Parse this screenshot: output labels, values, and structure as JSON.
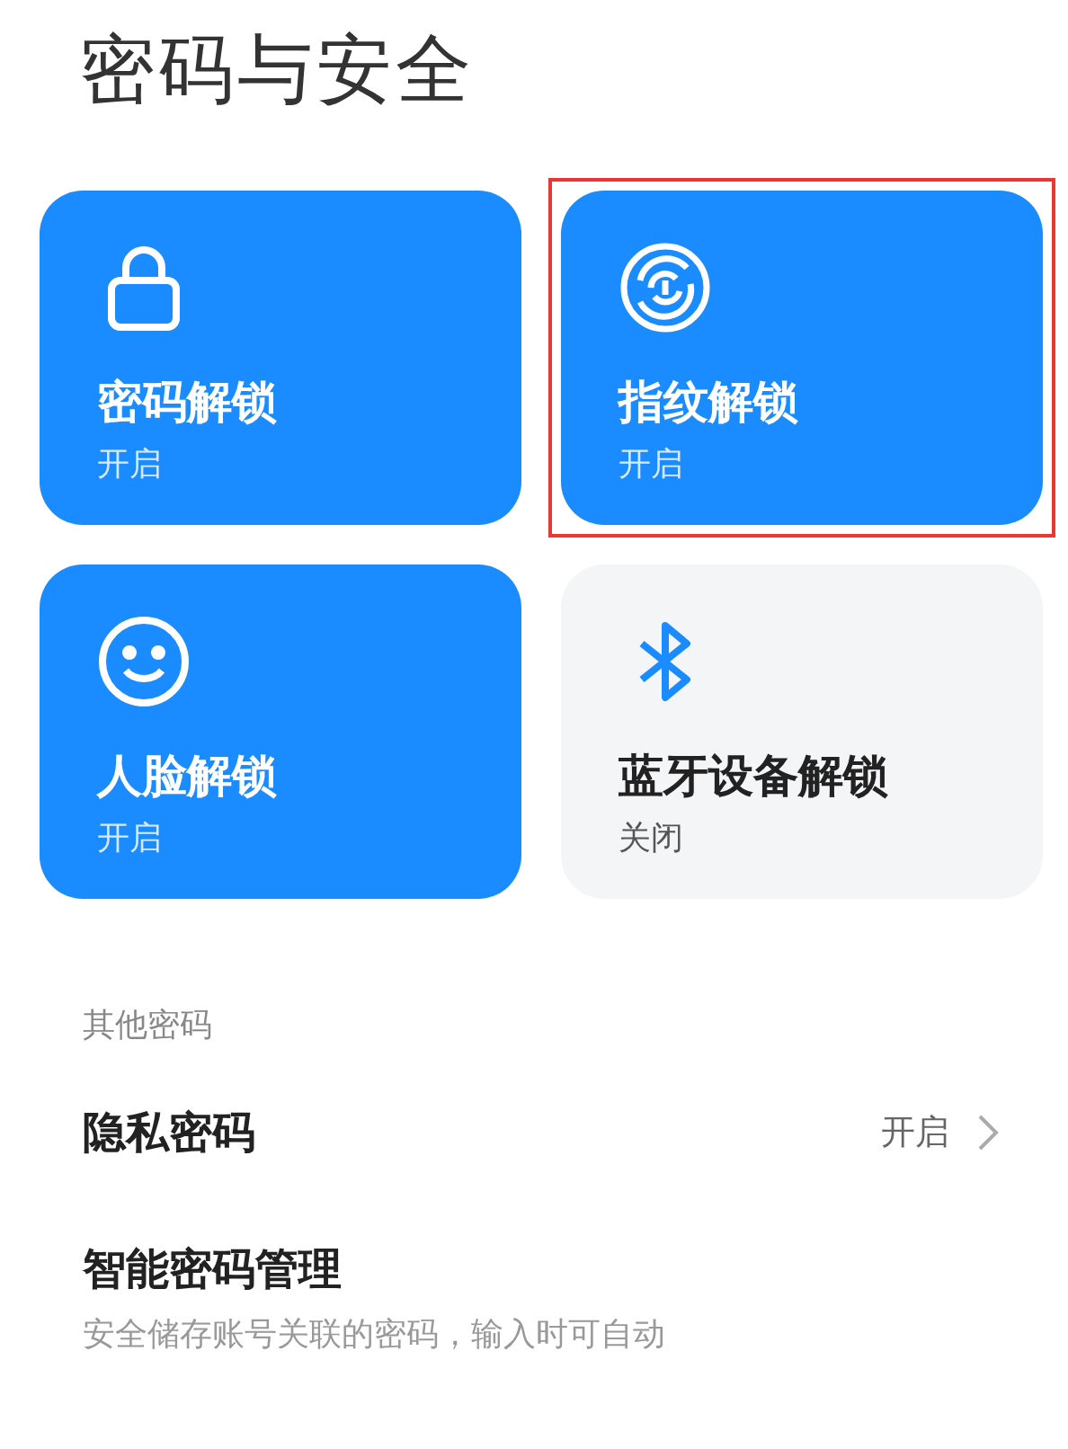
{
  "title": "密码与安全",
  "tiles": [
    {
      "kind": "lock",
      "label": "密码解锁",
      "status": "开启",
      "on": true,
      "highlighted": false
    },
    {
      "kind": "fingerprint",
      "label": "指纹解锁",
      "status": "开启",
      "on": true,
      "highlighted": true
    },
    {
      "kind": "face",
      "label": "人脸解锁",
      "status": "开启",
      "on": true,
      "highlighted": false
    },
    {
      "kind": "bluetooth",
      "label": "蓝牙设备解锁",
      "status": "关闭",
      "on": false,
      "highlighted": false
    }
  ],
  "section": {
    "header": "其他密码",
    "rows": [
      {
        "kind": "value",
        "title": "隐私密码",
        "value": "开启"
      },
      {
        "kind": "subtitle",
        "title": "智能密码管理",
        "subtitle": "安全储存账号关联的密码，输入时可自动"
      }
    ]
  }
}
